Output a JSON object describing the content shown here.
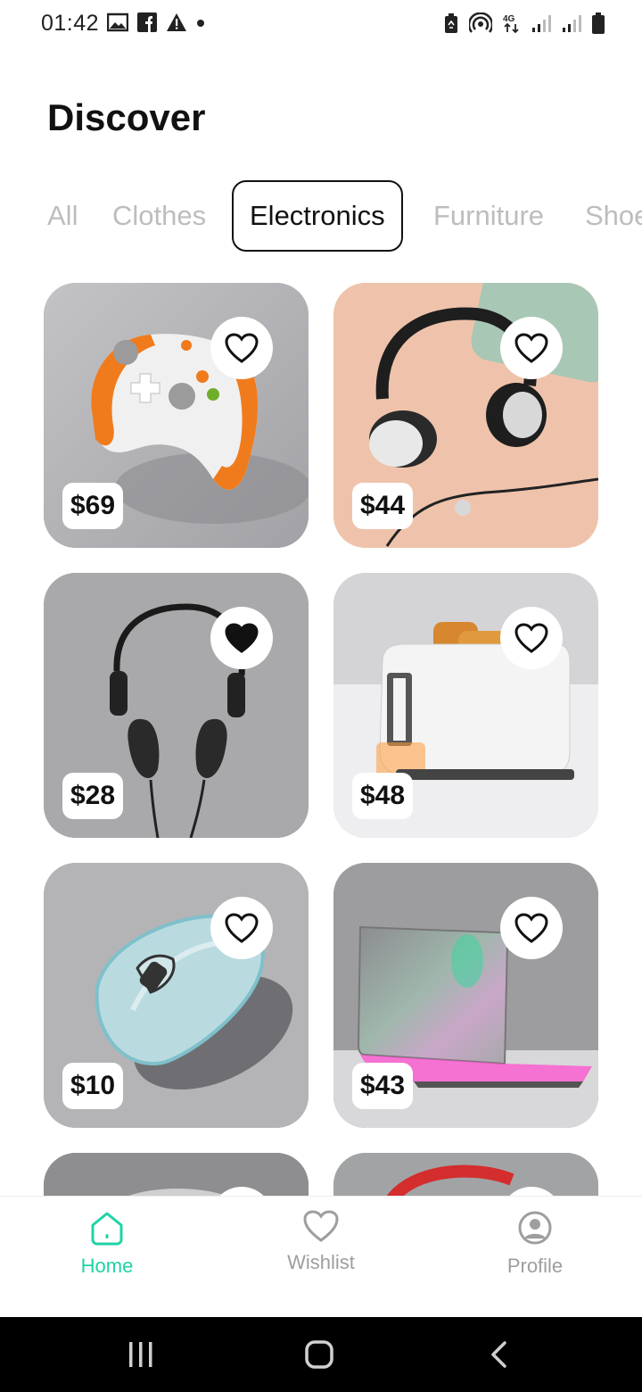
{
  "status_bar": {
    "time": "01:42",
    "left_icons": [
      "gallery-icon",
      "facebook-icon",
      "warning-icon",
      "dot-icon"
    ],
    "right_icons": [
      "battery-saver-icon",
      "hotspot-icon",
      "4g-icon",
      "signal-icon",
      "signal-icon",
      "battery-icon"
    ]
  },
  "header": {
    "title": "Discover"
  },
  "tabs": [
    {
      "label": "All",
      "active": false
    },
    {
      "label": "Clothes",
      "active": false
    },
    {
      "label": "Electronics",
      "active": true
    },
    {
      "label": "Furniture",
      "active": false
    },
    {
      "label": "Shoes",
      "active": false
    }
  ],
  "products": [
    {
      "image": "game-controller-image",
      "price": "$69",
      "favorite": false
    },
    {
      "image": "headphones-image",
      "price": "$44",
      "favorite": false
    },
    {
      "image": "wired-headphones-image",
      "price": "$28",
      "favorite": true
    },
    {
      "image": "toaster-image",
      "price": "$48",
      "favorite": false
    },
    {
      "image": "computer-mouse-image",
      "price": "$10",
      "favorite": false
    },
    {
      "image": "laptop-image",
      "price": "$43",
      "favorite": false
    }
  ],
  "bottom_nav": [
    {
      "label": "Home",
      "icon": "home-icon",
      "active": true
    },
    {
      "label": "Wishlist",
      "icon": "heart-icon",
      "active": false
    },
    {
      "label": "Profile",
      "icon": "profile-icon",
      "active": false
    }
  ],
  "colors": {
    "accent": "#1fd3a6",
    "inactive": "#9e9e9e",
    "tab_inactive": "#bdbdbd"
  }
}
